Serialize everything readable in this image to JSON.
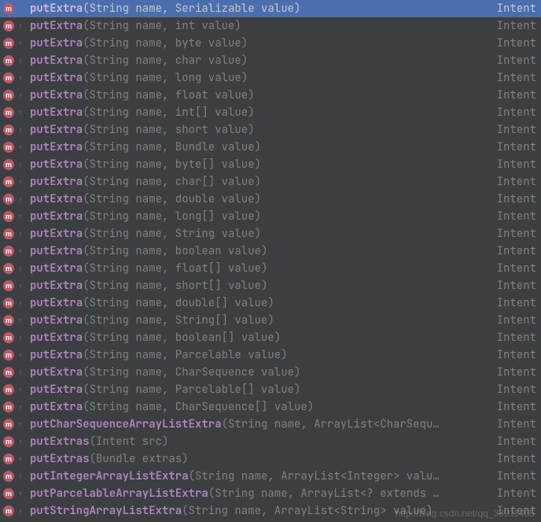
{
  "return_type": "Intent",
  "watermark": "http://blog.csdn.net/qq_33911465",
  "items": [
    {
      "selected": true,
      "prefix": "put",
      "match": "Extra",
      "params": "(String name, Serializable value)"
    },
    {
      "selected": false,
      "prefix": "put",
      "match": "Extra",
      "params": "(String name, int value)"
    },
    {
      "selected": false,
      "prefix": "put",
      "match": "Extra",
      "params": "(String name, byte value)"
    },
    {
      "selected": false,
      "prefix": "put",
      "match": "Extra",
      "params": "(String name, char value)"
    },
    {
      "selected": false,
      "prefix": "put",
      "match": "Extra",
      "params": "(String name, long value)"
    },
    {
      "selected": false,
      "prefix": "put",
      "match": "Extra",
      "params": "(String name, float value)"
    },
    {
      "selected": false,
      "prefix": "put",
      "match": "Extra",
      "params": "(String name, int[] value)"
    },
    {
      "selected": false,
      "prefix": "put",
      "match": "Extra",
      "params": "(String name, short value)"
    },
    {
      "selected": false,
      "prefix": "put",
      "match": "Extra",
      "params": "(String name, Bundle value)"
    },
    {
      "selected": false,
      "prefix": "put",
      "match": "Extra",
      "params": "(String name, byte[] value)"
    },
    {
      "selected": false,
      "prefix": "put",
      "match": "Extra",
      "params": "(String name, char[] value)"
    },
    {
      "selected": false,
      "prefix": "put",
      "match": "Extra",
      "params": "(String name, double value)"
    },
    {
      "selected": false,
      "prefix": "put",
      "match": "Extra",
      "params": "(String name, long[] value)"
    },
    {
      "selected": false,
      "prefix": "put",
      "match": "Extra",
      "params": "(String name, String value)"
    },
    {
      "selected": false,
      "prefix": "put",
      "match": "Extra",
      "params": "(String name, boolean value)"
    },
    {
      "selected": false,
      "prefix": "put",
      "match": "Extra",
      "params": "(String name, float[] value)"
    },
    {
      "selected": false,
      "prefix": "put",
      "match": "Extra",
      "params": "(String name, short[] value)"
    },
    {
      "selected": false,
      "prefix": "put",
      "match": "Extra",
      "params": "(String name, double[] value)"
    },
    {
      "selected": false,
      "prefix": "put",
      "match": "Extra",
      "params": "(String name, String[] value)"
    },
    {
      "selected": false,
      "prefix": "put",
      "match": "Extra",
      "params": "(String name, boolean[] value)"
    },
    {
      "selected": false,
      "prefix": "put",
      "match": "Extra",
      "params": "(String name, Parcelable value)"
    },
    {
      "selected": false,
      "prefix": "put",
      "match": "Extra",
      "params": "(String name, CharSequence value)"
    },
    {
      "selected": false,
      "prefix": "put",
      "match": "Extra",
      "params": "(String name, Parcelable[] value)"
    },
    {
      "selected": false,
      "prefix": "put",
      "match": "Extra",
      "params": "(String name, CharSequence[] value)"
    },
    {
      "selected": false,
      "prefix": "put",
      "match": "CharSequenceArrayListExtra",
      "params": "(String name, ArrayList<CharSequ…"
    },
    {
      "selected": false,
      "prefix": "put",
      "match": "Extras",
      "params": "(Intent src)"
    },
    {
      "selected": false,
      "prefix": "put",
      "match": "Extras",
      "params": "(Bundle extras)"
    },
    {
      "selected": false,
      "prefix": "put",
      "match": "IntegerArrayListExtra",
      "params": "(String name, ArrayList<Integer> valu…"
    },
    {
      "selected": false,
      "prefix": "put",
      "match": "ParcelableArrayListExtra",
      "params": "(String name, ArrayList<? extends …"
    },
    {
      "selected": false,
      "prefix": "put",
      "match": "StringArrayListExtra",
      "params": "(String name, ArrayList<String> value)"
    }
  ]
}
